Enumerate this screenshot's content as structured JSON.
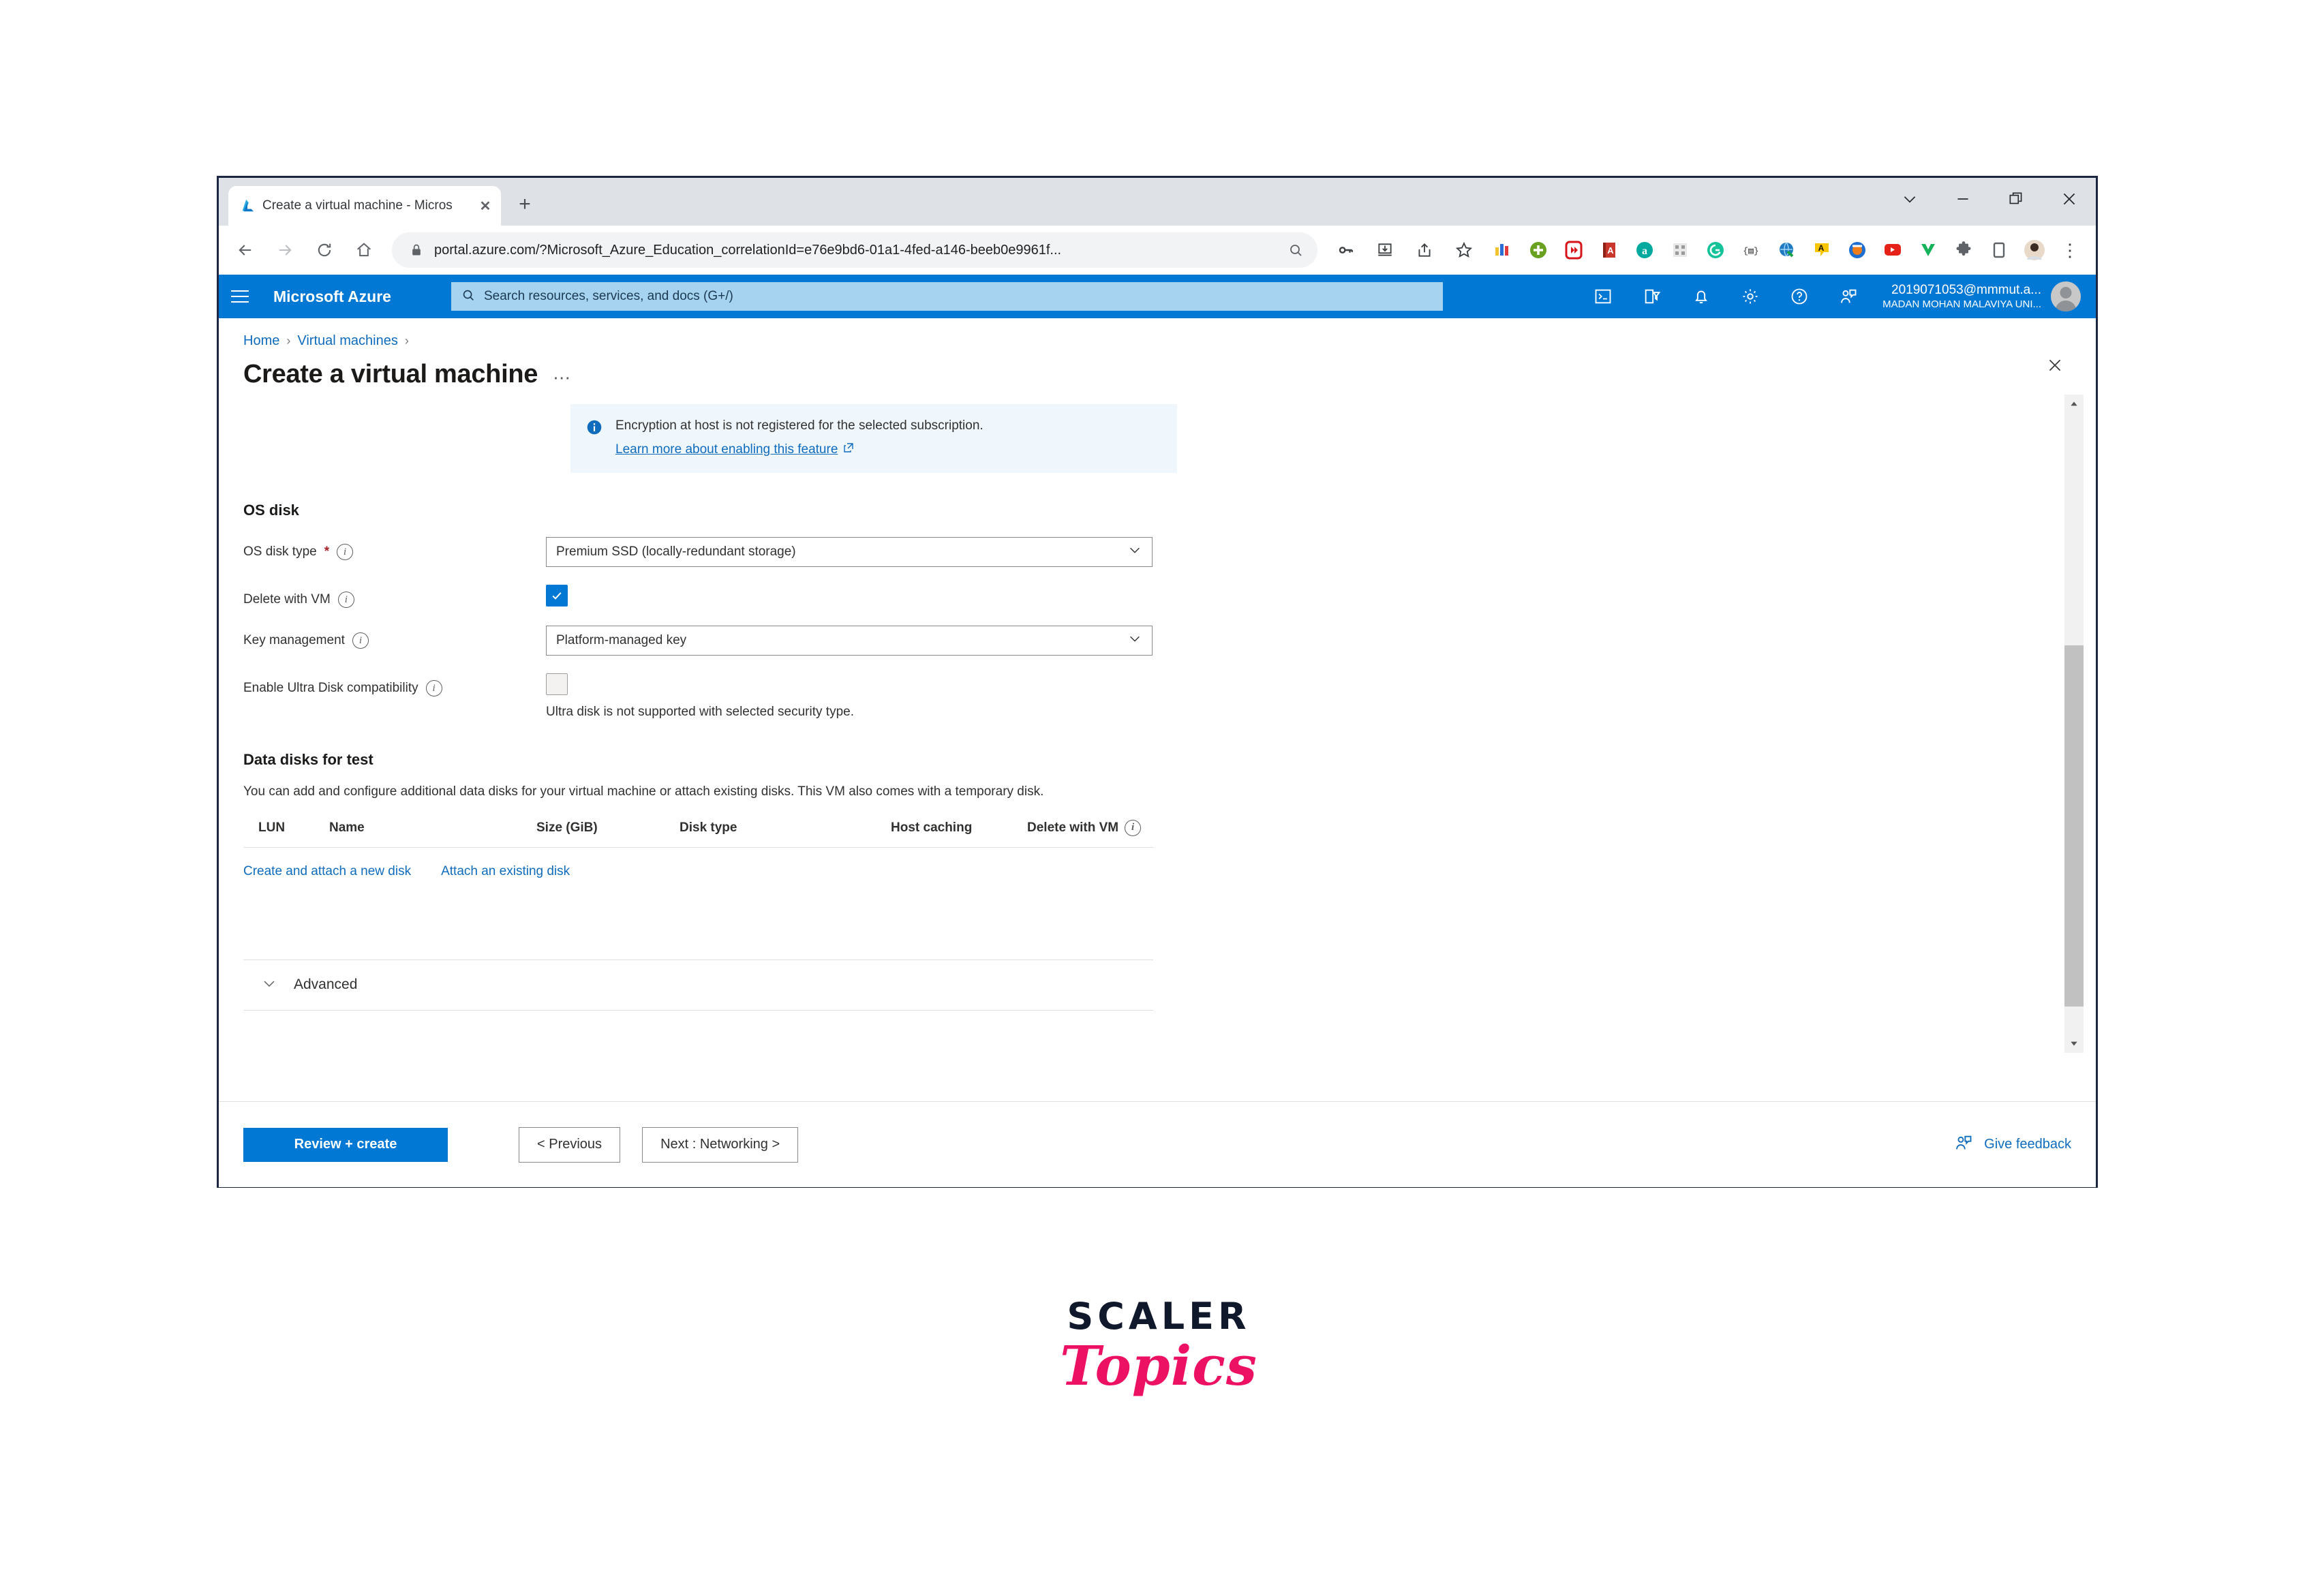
{
  "browser": {
    "tab": {
      "title": "Create a virtual machine - Micros",
      "favicon": "azure-logo-icon",
      "close_label": "✕"
    },
    "new_tab_label": "+",
    "window_controls": [
      {
        "name": "tab-search-button",
        "glyph": "∨"
      },
      {
        "name": "minimize-button",
        "glyph": "—"
      },
      {
        "name": "restore-button",
        "glyph": "❐"
      },
      {
        "name": "close-window-button",
        "glyph": "✕"
      }
    ],
    "nav": {
      "back_label": "←",
      "forward_label": "→",
      "reload_label": "⟳",
      "home_label": "⌂"
    },
    "omnibox": {
      "url": "portal.azure.com/?Microsoft_Azure_Education_correlationId=e76e9bd6-01a1-4fed-a146-beeb0e9961f...",
      "lock_icon": "lock-icon",
      "search_icon": "search-icon"
    },
    "omnibox_actions": [
      {
        "name": "password-key-icon",
        "glyph": "⚷"
      },
      {
        "name": "install-app-icon",
        "glyph": "⬇"
      },
      {
        "name": "share-icon",
        "glyph": "➦"
      },
      {
        "name": "bookmark-star-icon",
        "glyph": "☆"
      }
    ],
    "extensions": [
      {
        "name": "extension-colorbars-icon",
        "color": "#e8c320"
      },
      {
        "name": "extension-add-green-icon",
        "color": "#6aa121"
      },
      {
        "name": "extension-idm-icon",
        "color": "#d7141a"
      },
      {
        "name": "extension-dictionary-icon",
        "color": "#c9372c"
      },
      {
        "name": "extension-amazon-icon",
        "color": "#00a99d"
      },
      {
        "name": "extension-qrcode-icon",
        "color": "#cfcfcf"
      },
      {
        "name": "extension-grammarly-icon",
        "color": "#15c39a"
      },
      {
        "name": "extension-code-icon",
        "color": "#3a3a3a"
      },
      {
        "name": "extension-idm-globe-icon",
        "color": "#1f7ac4"
      },
      {
        "name": "extension-adblock-icon",
        "color": "#f7c600"
      },
      {
        "name": "extension-tab-orange-icon",
        "color": "#ef7d1a"
      },
      {
        "name": "extension-youtube-icon",
        "color": "#e62117"
      },
      {
        "name": "extension-wotvideo-icon",
        "color": "#16b35b"
      },
      {
        "name": "extensions-puzzle-icon",
        "color": "#5f6368"
      },
      {
        "name": "collections-icon",
        "color": "#5f6368"
      }
    ],
    "profile_icon": "profile-avatar",
    "more_menu_label": "⋮"
  },
  "azure_header": {
    "brand": "Microsoft Azure",
    "search_placeholder": "Search resources, services, and docs (G+/)",
    "icons": [
      {
        "name": "cloud-shell-icon",
        "glyph": ">_"
      },
      {
        "name": "directories-subscriptions-icon",
        "glyph": "filter"
      },
      {
        "name": "notifications-bell-icon",
        "glyph": "bell"
      },
      {
        "name": "settings-gear-icon",
        "glyph": "gear"
      },
      {
        "name": "help-icon",
        "glyph": "?"
      },
      {
        "name": "feedback-icon",
        "glyph": "person-comment"
      }
    ],
    "account": {
      "email": "2019071053@mmmut.a...",
      "org": "MADAN MOHAN MALAVIYA UNI..."
    }
  },
  "breadcrumb": {
    "items": [
      "Home",
      "Virtual machines"
    ],
    "separator": "›"
  },
  "page": {
    "title": "Create a virtual machine",
    "ellipsis": "⋯",
    "close_label": "✕"
  },
  "info_banner": {
    "icon": "info-icon",
    "message": "Encryption at host is not registered for the selected subscription.",
    "link_text": "Learn more about enabling this feature",
    "external_icon": "external-link-icon"
  },
  "os_disk": {
    "heading": "OS disk",
    "fields": {
      "disk_type": {
        "label": "OS disk type",
        "required_mark": "*",
        "value": "Premium SSD (locally-redundant storage)"
      },
      "delete_with_vm": {
        "label": "Delete with VM",
        "checked": true,
        "check_glyph": "✓"
      },
      "key_management": {
        "label": "Key management",
        "value": "Platform-managed key"
      },
      "ultra_disk": {
        "label": "Enable Ultra Disk compatibility",
        "checked": false,
        "helper": "Ultra disk is not supported with selected security type."
      }
    }
  },
  "data_disks": {
    "heading": "Data disks for test",
    "description": "You can add and configure additional data disks for your virtual machine or attach existing disks. This VM also comes with a temporary disk.",
    "columns": [
      "LUN",
      "Name",
      "Size (GiB)",
      "Disk type",
      "Host caching",
      "Delete with VM"
    ],
    "rows": [],
    "links": [
      {
        "name": "create-and-attach-new-disk-link",
        "label": "Create and attach a new disk"
      },
      {
        "name": "attach-existing-disk-link",
        "label": "Attach an existing disk"
      }
    ]
  },
  "advanced": {
    "label": "Advanced",
    "expanded": false,
    "chevron": "∨"
  },
  "footer": {
    "review_create": "Review + create",
    "previous": "< Previous",
    "next": "Next : Networking >",
    "feedback": "Give feedback"
  },
  "watermark": {
    "line1": "SCALER",
    "line2": "Topics"
  },
  "colors": {
    "azure_blue": "#0078d4",
    "link_blue": "#0f6cbd",
    "banner_bg": "#eff6fc",
    "required_red": "#a4262c",
    "scaler_dark": "#10182b",
    "scaler_pink": "#ed1164"
  }
}
